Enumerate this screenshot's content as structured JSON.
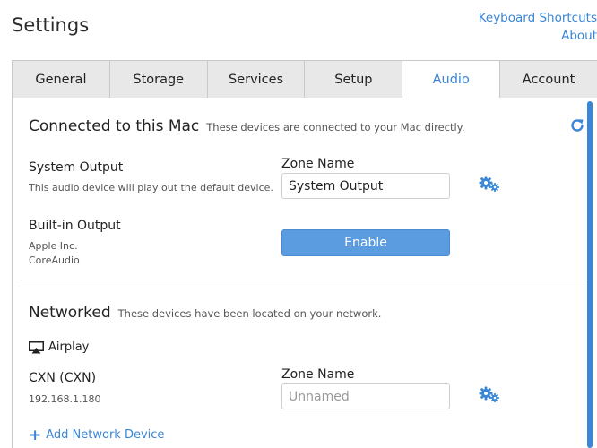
{
  "header": {
    "title": "Settings",
    "links": [
      "Keyboard Shortcuts",
      "About"
    ]
  },
  "tabs": [
    {
      "label": "General"
    },
    {
      "label": "Storage"
    },
    {
      "label": "Services"
    },
    {
      "label": "Setup"
    },
    {
      "label": "Audio",
      "active": true
    },
    {
      "label": "Account"
    }
  ],
  "connected": {
    "title": "Connected to this Mac",
    "subtitle": "These devices are connected to your Mac directly.",
    "refresh_icon": "refresh-icon",
    "devices": [
      {
        "name": "System Output",
        "description": "This audio device will play out the default device.",
        "zone_label": "Zone Name",
        "zone_value": "System Output"
      },
      {
        "name": "Built-in Output",
        "vendor": "Apple Inc.",
        "driver": "CoreAudio",
        "button_label": "Enable"
      }
    ]
  },
  "networked": {
    "title": "Networked",
    "subtitle": "These devices have been located on your network.",
    "group_label": "Airplay",
    "devices": [
      {
        "name": "CXN (CXN)",
        "ip": "192.168.1.180",
        "zone_label": "Zone Name",
        "zone_placeholder": "Unnamed"
      }
    ],
    "add_label": "Add Network Device"
  },
  "colors": {
    "accent": "#3a86d6",
    "button": "#5b9be0",
    "tab_inactive": "#e8e8e8"
  }
}
